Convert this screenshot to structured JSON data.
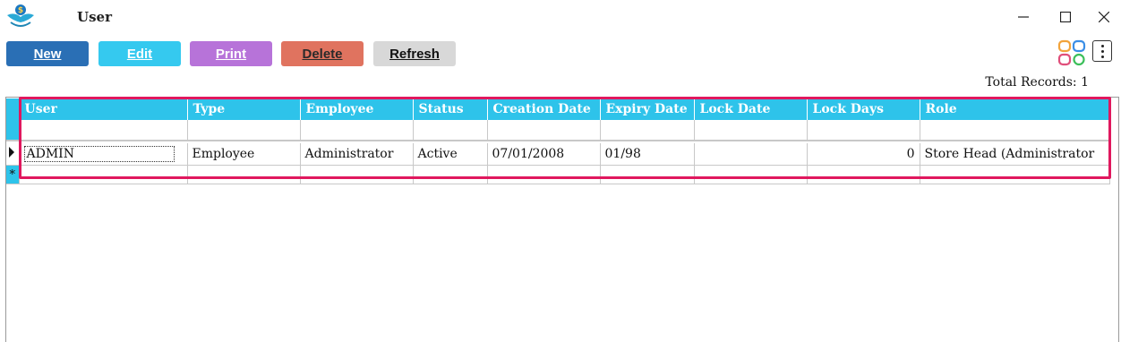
{
  "window": {
    "title": "User"
  },
  "toolbar": {
    "buttons": [
      {
        "label": "New",
        "bg": "#2a6fb5",
        "fg": "#ffffff"
      },
      {
        "label": "Edit",
        "bg": "#35c9ef",
        "fg": "#ffffff"
      },
      {
        "label": "Print",
        "bg": "#b773d9",
        "fg": "#ffffff"
      },
      {
        "label": "Delete",
        "bg": "#e0735f",
        "fg": "#2a2a2a"
      },
      {
        "label": "Refresh",
        "bg": "#d8d8d8",
        "fg": "#111111"
      }
    ]
  },
  "total_records": "Total Records: 1",
  "grid": {
    "columns": [
      "User",
      "Type",
      "Employee",
      "Status",
      "Creation Date",
      "Expiry Date",
      "Lock Date",
      "Lock Days",
      "Role"
    ],
    "rows": [
      [
        "ADMIN",
        "Employee",
        "Administrator",
        "Active",
        "07/01/2008",
        "01/98",
        "",
        "0",
        "Store Head (Administrator"
      ]
    ],
    "new_row_marker": "*"
  },
  "colors": {
    "header": "#2ec3ea",
    "highlight": "#e0185e"
  }
}
